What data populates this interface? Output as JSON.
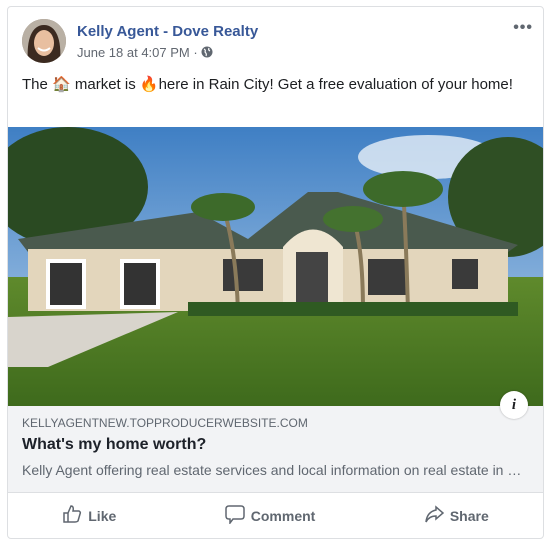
{
  "post": {
    "author": "Kelly Agent - Dove Realty",
    "timestamp": "June 18 at 4:07 PM",
    "separator": "·",
    "privacy_icon": "globe-icon",
    "more_label": "•••",
    "message_parts": [
      "The ",
      "🏠",
      " market is ",
      "🔥",
      "here in Rain City! Get a free evaluation of your home!"
    ]
  },
  "link_preview": {
    "domain": "KELLYAGENTNEW.TOPPRODUCERWEBSITE.COM",
    "title": "What's my home worth?",
    "description": "Kelly Agent offering real estate services and local information on real estate in Rain City",
    "info_label": "i"
  },
  "actions": [
    {
      "label": "Like",
      "icon": "thumbs-up-icon"
    },
    {
      "label": "Comment",
      "icon": "comment-icon"
    },
    {
      "label": "Share",
      "icon": "share-icon"
    }
  ]
}
